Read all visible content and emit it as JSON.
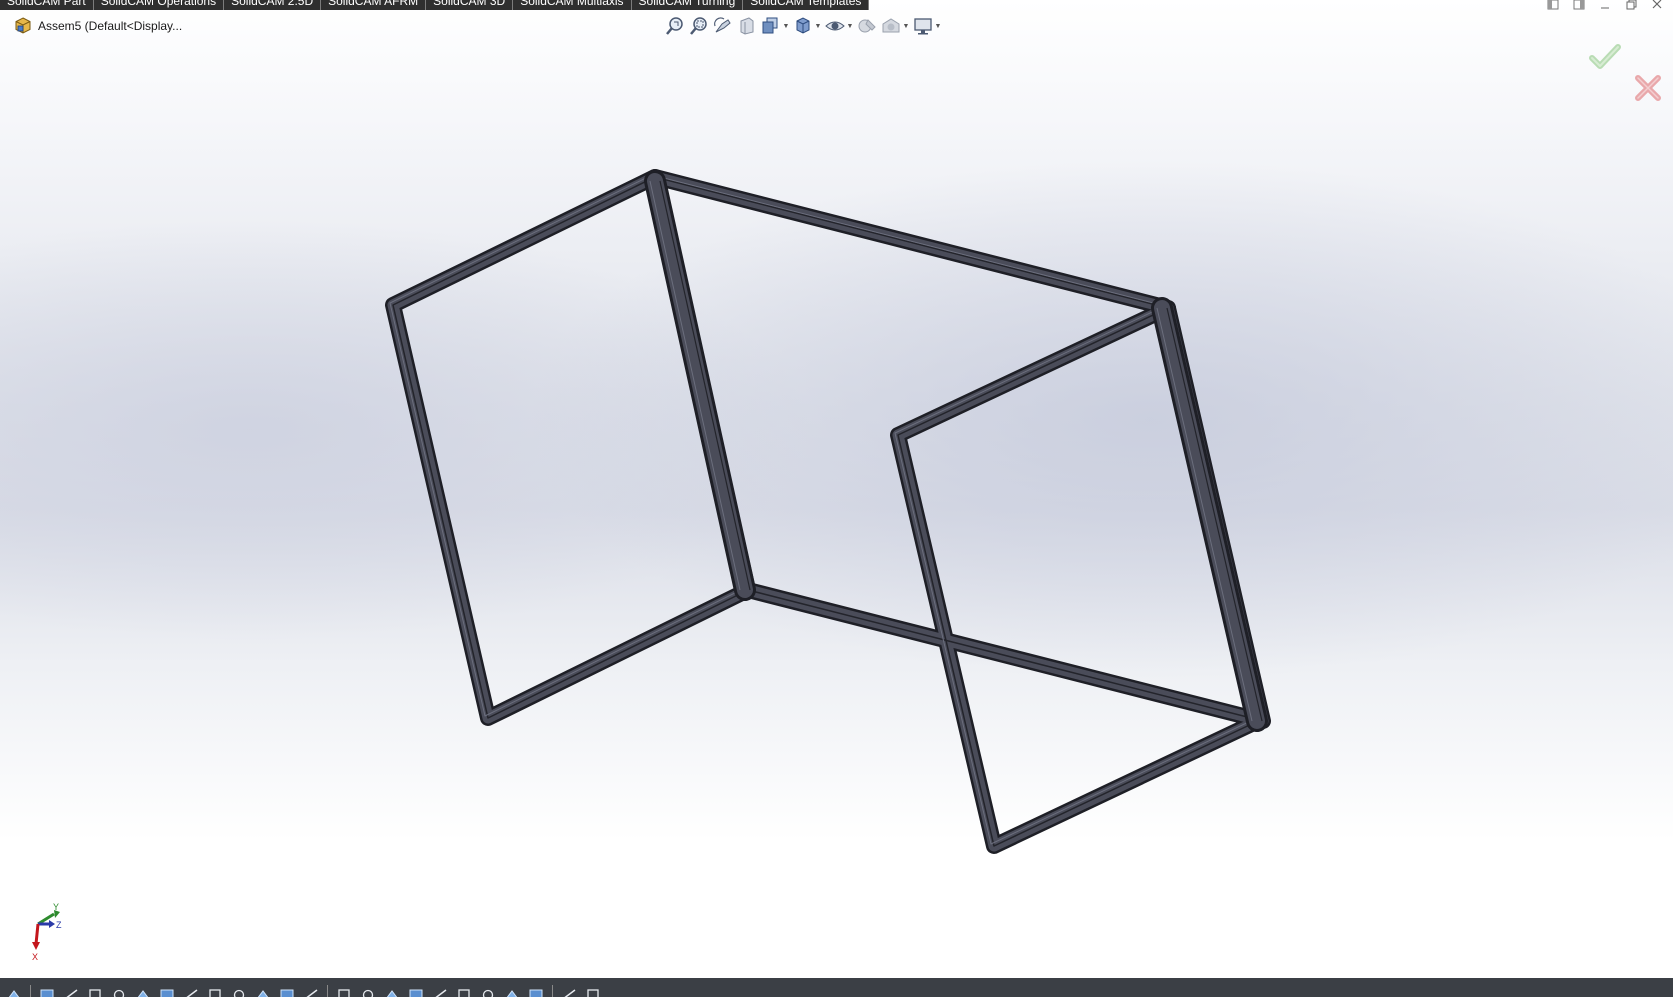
{
  "cam_tabs": [
    "SolidCAM Part",
    "SolidCAM Operations",
    "SolidCAM 2.5D",
    "SolidCAM AFRM",
    "SolidCAM 3D",
    "SolidCAM Multiaxis",
    "SolidCAM Turning",
    "SolidCAM Templates"
  ],
  "document": {
    "title": "Assem5  (Default<Display..."
  },
  "heads_up_toolbar": [
    {
      "icon": "zoom-to-fit-icon",
      "dropdown": false
    },
    {
      "icon": "zoom-to-area-icon",
      "dropdown": false
    },
    {
      "icon": "previous-view-icon",
      "dropdown": false
    },
    {
      "icon": "section-view-icon",
      "dropdown": false
    },
    {
      "icon": "view-orientation-icon",
      "dropdown": true
    },
    {
      "icon": "display-style-icon",
      "dropdown": true
    },
    {
      "icon": "hide-show-items-icon",
      "dropdown": true
    },
    {
      "icon": "edit-appearance-icon",
      "dropdown": false
    },
    {
      "icon": "apply-scene-icon",
      "dropdown": true
    },
    {
      "icon": "view-settings-icon",
      "dropdown": true
    }
  ],
  "window_controls": [
    "tile-left-icon",
    "tile-right-icon",
    "minimize-icon",
    "restore-icon",
    "close-icon"
  ],
  "confirmation_corner": {
    "ok_icon": "checkmark-icon",
    "cancel_icon": "x-icon",
    "ok_color": "#b9dcb4",
    "cancel_color": "#e9a8ab"
  },
  "triad": {
    "y_label": "Y",
    "z_label": "Z",
    "x_label": "X"
  },
  "colors": {
    "frame_face": "#4a4c59",
    "frame_edge": "#1e1f26",
    "frame_highlight": "#6b6e7d",
    "bottom_bar": "#3b3f45"
  },
  "bottom_toolbar": [
    "sketch-icon",
    "smart-dimension-icon",
    "line-icon",
    "rectangle-icon",
    "circle-icon",
    "arc-icon",
    "spline-icon",
    "trim-icon",
    "convert-entities-icon",
    "offset-icon",
    "mirror-icon",
    "linear-pattern-icon",
    "move-icon",
    "relations-icon",
    "fix-icon",
    "note-icon",
    "text-icon",
    "cosmetic-thread-icon",
    "hole-wizard-icon",
    "table-icon",
    "image-icon",
    "pie-icon",
    "layout-icon",
    "more-icon"
  ]
}
